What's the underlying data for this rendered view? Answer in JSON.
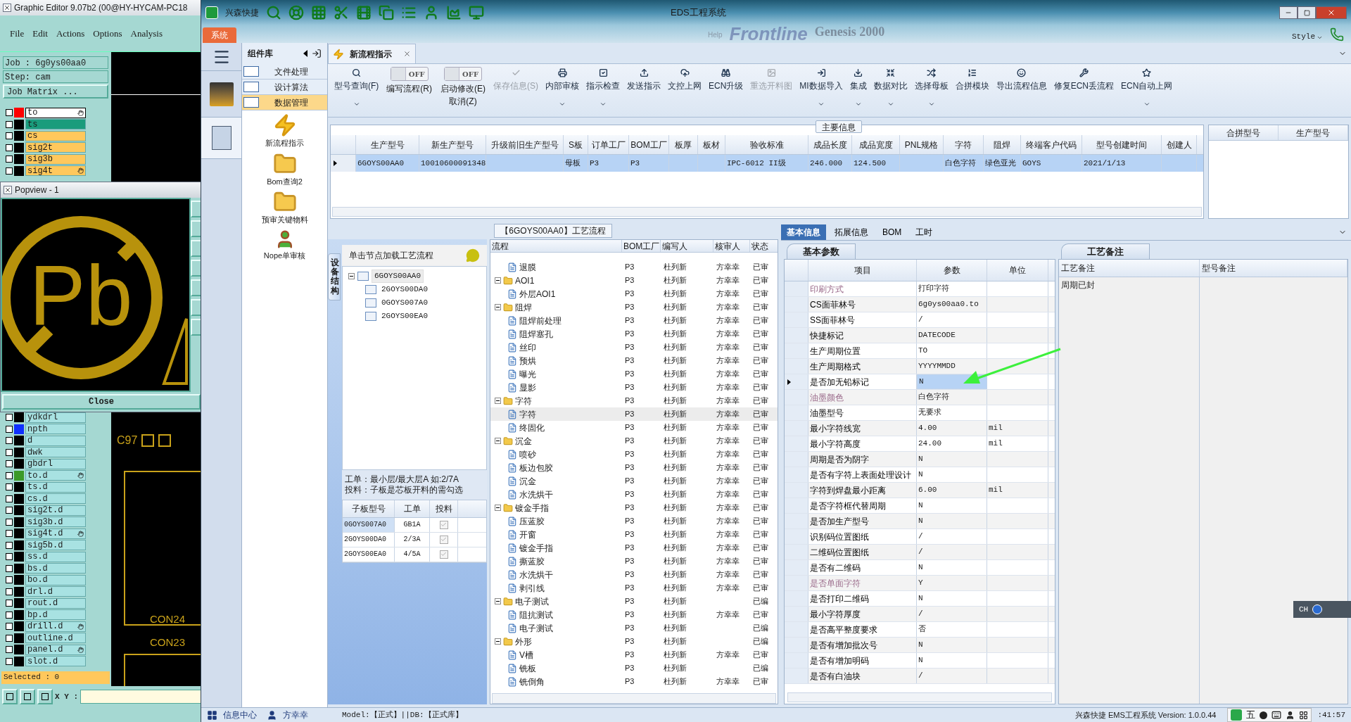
{
  "graphic_editor": {
    "title": "Graphic Editor 9.07b2 (00@HY-HYCAM-PC18",
    "menu": [
      "File",
      "Edit",
      "Actions",
      "Options",
      "Analysis"
    ],
    "job": "Job : 6g0ys00aa0",
    "step": "Step: cam",
    "job_matrix_button": "Job Matrix ...",
    "layers_top": [
      {
        "name": "to",
        "color": "#ffffff",
        "swatch": {
          "color": "#ff0000"
        },
        "selected": true,
        "marked": true,
        "checked": false
      },
      {
        "name": "ts",
        "color": "#1a9c7c",
        "selected": false,
        "marked": false,
        "checked": false
      },
      {
        "name": "cs",
        "color": "#ffc85c",
        "selected": false,
        "marked": false,
        "checked": false
      },
      {
        "name": "sig2t",
        "color": "#ffc85c",
        "selected": false,
        "marked": false,
        "checked": false
      },
      {
        "name": "sig3b",
        "color": "#ffc85c",
        "selected": false,
        "marked": false,
        "checked": false
      },
      {
        "name": "sig4t",
        "color": "#ffc85c",
        "selected": false,
        "marked": true,
        "checked": false
      }
    ],
    "layers_bottom": [
      {
        "name": "ydkdrl",
        "color": "#a8e2e2",
        "selected": false,
        "marked": false,
        "checked": false
      },
      {
        "name": "npth",
        "color": "#a8e2e2",
        "swatch": {
          "color": "#1030ff"
        },
        "selected": false,
        "marked": false,
        "checked": false
      },
      {
        "name": "d",
        "color": "#a8e2e2",
        "selected": false,
        "marked": false,
        "checked": false
      },
      {
        "name": "dwk",
        "color": "#a8e2e2",
        "selected": false,
        "marked": false,
        "checked": false
      },
      {
        "name": "gbdrl",
        "color": "#a8e2e2",
        "selected": false,
        "marked": false,
        "checked": false
      },
      {
        "name": "to.d",
        "color": "#a8e2e2",
        "swatch": {
          "color": "#3c9a28"
        },
        "selected": false,
        "marked": true,
        "checked": false
      },
      {
        "name": "ts.d",
        "color": "#a8e2e2",
        "selected": false,
        "marked": false,
        "checked": false
      },
      {
        "name": "cs.d",
        "color": "#a8e2e2",
        "selected": false,
        "marked": false,
        "checked": false
      },
      {
        "name": "sig2t.d",
        "color": "#a8e2e2",
        "selected": false,
        "marked": false,
        "checked": false
      },
      {
        "name": "sig3b.d",
        "color": "#a8e2e2",
        "selected": false,
        "marked": false,
        "checked": false
      },
      {
        "name": "sig4t.d",
        "color": "#a8e2e2",
        "selected": false,
        "marked": true,
        "checked": false
      },
      {
        "name": "sig5b.d",
        "color": "#a8e2e2",
        "selected": false,
        "marked": false,
        "checked": false
      },
      {
        "name": "ss.d",
        "color": "#a8e2e2",
        "selected": false,
        "marked": false,
        "checked": false
      },
      {
        "name": "bs.d",
        "color": "#a8e2e2",
        "selected": false,
        "marked": false,
        "checked": false
      },
      {
        "name": "bo.d",
        "color": "#a8e2e2",
        "selected": false,
        "marked": false,
        "checked": false
      },
      {
        "name": "drl.d",
        "color": "#a8e2e2",
        "selected": false,
        "marked": false,
        "checked": false
      },
      {
        "name": "rout.d",
        "color": "#a8e2e2",
        "selected": false,
        "marked": false,
        "checked": false
      },
      {
        "name": "bp.d",
        "color": "#a8e2e2",
        "selected": false,
        "marked": false,
        "checked": false
      },
      {
        "name": "drill.d",
        "color": "#a8e2e2",
        "selected": false,
        "marked": true,
        "checked": false
      },
      {
        "name": "outline.d",
        "color": "#a8e2e2",
        "selected": false,
        "marked": false,
        "checked": false
      },
      {
        "name": "panel.d",
        "color": "#a8e2e2",
        "selected": false,
        "marked": true,
        "checked": false
      },
      {
        "name": "slot.d",
        "color": "#a8e2e2",
        "selected": false,
        "marked": false,
        "checked": false
      }
    ],
    "selected_count": "Selected : 0",
    "xy_label": "X Y :",
    "canvas_labels": [
      "C97",
      "CON24",
      "CON23"
    ]
  },
  "popview": {
    "title": "Popview - 1",
    "symbol": "Pb",
    "close_button": "Close"
  },
  "eds": {
    "app_name": "兴森快捷",
    "title": "EDS工程系统",
    "background_texts": [
      "Help",
      "Frontline",
      "Genesis 2000"
    ],
    "style_menu": "Style",
    "ribbon_tab": "系统",
    "library": {
      "title": "组件库",
      "groups": [
        {
          "label": "文件处理",
          "selected": false
        },
        {
          "label": "设计算法",
          "selected": false
        },
        {
          "label": "数据管理",
          "selected": true
        }
      ],
      "tools": [
        {
          "label": "新流程指示",
          "kind": "bolt"
        },
        {
          "label": "Bom查询2",
          "kind": "folder"
        },
        {
          "label": "预审关键物料",
          "kind": "folder"
        },
        {
          "label": "Nope单审核",
          "kind": "person"
        }
      ]
    },
    "doc_tab": {
      "label": "新流程指示",
      "selected": true
    },
    "toolbar": [
      {
        "kind": "button",
        "label": "型号查询(F)",
        "disabled": false,
        "menu": true
      },
      {
        "kind": "toggle",
        "label": "编写流程(R)",
        "toggle_text": "OFF",
        "on": false
      },
      {
        "kind": "toggle",
        "label": "启动修改(E)",
        "label2": "取消(Z)",
        "toggle_text": "OFF",
        "on": false
      },
      {
        "kind": "button",
        "label": "保存信息(S)",
        "disabled": true,
        "menu": false
      },
      {
        "kind": "button",
        "label": "内部审核",
        "disabled": false,
        "menu": true
      },
      {
        "kind": "button",
        "label": "指示检查",
        "disabled": false,
        "menu": true
      },
      {
        "kind": "button",
        "label": "发送指示",
        "disabled": false,
        "menu": false
      },
      {
        "kind": "button",
        "label": "文控上网",
        "disabled": false,
        "menu": false
      },
      {
        "kind": "button",
        "label": "ECN升级",
        "disabled": false,
        "menu": false
      },
      {
        "kind": "button",
        "label": "重选开料图",
        "disabled": true,
        "menu": false
      },
      {
        "kind": "button",
        "label": "MI数据导入",
        "disabled": false,
        "menu": true
      },
      {
        "kind": "button",
        "label": "集成",
        "disabled": false,
        "menu": true
      },
      {
        "kind": "button",
        "label": "数据对比",
        "disabled": false,
        "menu": true
      },
      {
        "kind": "button",
        "label": "选择母板",
        "disabled": false,
        "menu": true
      },
      {
        "kind": "button",
        "label": "合拼模块",
        "disabled": false,
        "menu": false
      },
      {
        "kind": "button",
        "label": "导出流程信息",
        "disabled": false,
        "menu": false
      },
      {
        "kind": "button",
        "label": "修复ECN丢流程",
        "disabled": false,
        "menu": false
      },
      {
        "kind": "button",
        "label": "ECN自动上网",
        "disabled": false,
        "menu": true
      }
    ],
    "main_info": {
      "legend": "主要信息",
      "columns": [
        "生产型号",
        "新生产型号",
        "升级前旧生产型号",
        "S板",
        "订单工厂",
        "BOM工厂",
        "板厚",
        "板材",
        "验收标准",
        "成品长度",
        "成品宽度",
        "PNL规格",
        "字符",
        "阻焊",
        "终端客户代码",
        "型号创建时间",
        "创建人"
      ],
      "rows": [
        {
          "selected": true,
          "cells": [
            "6GOYS00AA0",
            "10010600091348",
            "",
            "母板",
            "P3",
            "P3",
            "",
            "",
            "IPC-6012 II级",
            "246.000",
            "124.500",
            "",
            "白色字符",
            "绿色亚光",
            "GOYS",
            "2021/1/13",
            ""
          ]
        }
      ],
      "merge_columns": [
        "合拼型号",
        "生产型号"
      ]
    },
    "process": {
      "title": "【6GOYS00AA0】工艺流程",
      "side_tab": "设备结构",
      "tree_hint": "单击节点加载工艺流程",
      "tree": [
        {
          "label": "6GOYS00AA0",
          "expanded": true,
          "selected": true,
          "children": [
            {
              "label": "2GOYS00DA0",
              "selected": false
            },
            {
              "label": "0GOYS007A0",
              "selected": false
            },
            {
              "label": "2GOYS00EA0",
              "selected": false
            }
          ]
        }
      ],
      "note": [
        "工单：最小层/最大层A 如:2/7A",
        "投料：子板是芯板开料的需勾选"
      ],
      "sub_columns": [
        "子板型号",
        "工单",
        "投料"
      ],
      "sub_rows": [
        {
          "cells": [
            "0GOYS007A0",
            "GB1A"
          ],
          "checked": true,
          "selected": true
        },
        {
          "cells": [
            "2GOYS00DA0",
            "2/3A"
          ],
          "checked": true,
          "selected": false
        },
        {
          "cells": [
            "2GOYS00EA0",
            "4/5A"
          ],
          "checked": true,
          "selected": false
        }
      ],
      "grid_columns": [
        "流程",
        "BOM工厂",
        "编写人",
        "核审人",
        "状态"
      ],
      "grid_rows": [
        {
          "kind": "step",
          "cells": [
            "退膜",
            "P3",
            "杜列新",
            "方幸幸",
            "已审"
          ],
          "selected": false
        },
        {
          "kind": "group",
          "expanded": true,
          "cells": [
            "AOI1",
            "P3",
            "杜列新",
            "方幸幸",
            "已审"
          ],
          "selected": false,
          "children": [
            {
              "kind": "step",
              "cells": [
                "外层AOI1",
                "P3",
                "杜列新",
                "方幸幸",
                "已审"
              ],
              "selected": false
            }
          ]
        },
        {
          "kind": "group",
          "expanded": true,
          "cells": [
            "阻焊",
            "P3",
            "杜列新",
            "方幸幸",
            "已审"
          ],
          "selected": false,
          "children": [
            {
              "kind": "step",
              "cells": [
                "阻焊前处理",
                "P3",
                "杜列新",
                "方幸幸",
                "已审"
              ],
              "selected": false
            },
            {
              "kind": "step",
              "cells": [
                "阻焊塞孔",
                "P3",
                "杜列新",
                "方幸幸",
                "已审"
              ],
              "selected": false
            },
            {
              "kind": "step",
              "cells": [
                "丝印",
                "P3",
                "杜列新",
                "方幸幸",
                "已审"
              ],
              "selected": false
            },
            {
              "kind": "step",
              "cells": [
                "预烘",
                "P3",
                "杜列新",
                "方幸幸",
                "已审"
              ],
              "selected": false
            },
            {
              "kind": "step",
              "cells": [
                "曝光",
                "P3",
                "杜列新",
                "方幸幸",
                "已审"
              ],
              "selected": false
            },
            {
              "kind": "step",
              "cells": [
                "显影",
                "P3",
                "杜列新",
                "方幸幸",
                "已审"
              ],
              "selected": false
            }
          ]
        },
        {
          "kind": "group",
          "expanded": true,
          "cells": [
            "字符",
            "P3",
            "杜列新",
            "方幸幸",
            "已审"
          ],
          "selected": false,
          "children": [
            {
              "kind": "step",
              "cells": [
                "字符",
                "P3",
                "杜列新",
                "方幸幸",
                "已审"
              ],
              "selected": true
            },
            {
              "kind": "step",
              "cells": [
                "终固化",
                "P3",
                "杜列新",
                "方幸幸",
                "已审"
              ],
              "selected": false
            }
          ]
        },
        {
          "kind": "group",
          "expanded": true,
          "cells": [
            "沉金",
            "P3",
            "杜列新",
            "方幸幸",
            "已审"
          ],
          "selected": false,
          "children": [
            {
              "kind": "step",
              "cells": [
                "喷砂",
                "P3",
                "杜列新",
                "方幸幸",
                "已审"
              ],
              "selected": false
            },
            {
              "kind": "step",
              "cells": [
                "板边包胶",
                "P3",
                "杜列新",
                "方幸幸",
                "已审"
              ],
              "selected": false
            },
            {
              "kind": "step",
              "cells": [
                "沉金",
                "P3",
                "杜列新",
                "方幸幸",
                "已审"
              ],
              "selected": false
            },
            {
              "kind": "step",
              "cells": [
                "水洗烘干",
                "P3",
                "杜列新",
                "方幸幸",
                "已审"
              ],
              "selected": false
            }
          ]
        },
        {
          "kind": "group",
          "expanded": true,
          "cells": [
            "镀金手指",
            "P3",
            "杜列新",
            "方幸幸",
            "已审"
          ],
          "selected": false,
          "children": [
            {
              "kind": "step",
              "cells": [
                "压蓝胶",
                "P3",
                "杜列新",
                "方幸幸",
                "已审"
              ],
              "selected": false
            },
            {
              "kind": "step",
              "cells": [
                "开窗",
                "P3",
                "杜列新",
                "方幸幸",
                "已审"
              ],
              "selected": false
            },
            {
              "kind": "step",
              "cells": [
                "镀金手指",
                "P3",
                "杜列新",
                "方幸幸",
                "已审"
              ],
              "selected": false
            },
            {
              "kind": "step",
              "cells": [
                "撕蓝胶",
                "P3",
                "杜列新",
                "方幸幸",
                "已审"
              ],
              "selected": false
            },
            {
              "kind": "step",
              "cells": [
                "水洗烘干",
                "P3",
                "杜列新",
                "方幸幸",
                "已审"
              ],
              "selected": false
            },
            {
              "kind": "step",
              "cells": [
                "剥引线",
                "P3",
                "杜列新",
                "方幸幸",
                "已审"
              ],
              "selected": false
            }
          ]
        },
        {
          "kind": "group",
          "expanded": true,
          "cells": [
            "电子测试",
            "P3",
            "杜列新",
            "",
            "已编"
          ],
          "selected": false,
          "children": [
            {
              "kind": "step",
              "cells": [
                "阻抗测试",
                "P3",
                "杜列新",
                "方幸幸",
                "已审"
              ],
              "selected": false
            },
            {
              "kind": "step",
              "cells": [
                "电子测试",
                "P3",
                "杜列新",
                "",
                "已编"
              ],
              "selected": false
            }
          ]
        },
        {
          "kind": "group",
          "expanded": true,
          "cells": [
            "外形",
            "P3",
            "杜列新",
            "",
            "已编"
          ],
          "selected": false,
          "children": [
            {
              "kind": "step",
              "cells": [
                "V槽",
                "P3",
                "杜列新",
                "方幸幸",
                "已审"
              ],
              "selected": false
            },
            {
              "kind": "step",
              "cells": [
                "铣板",
                "P3",
                "杜列新",
                "",
                "已编"
              ],
              "selected": false
            },
            {
              "kind": "step",
              "cells": [
                "铣倒角",
                "P3",
                "杜列新",
                "方幸幸",
                "已审"
              ],
              "selected": false
            }
          ]
        }
      ]
    },
    "info_tabs": [
      {
        "label": "基本信息",
        "selected": true
      },
      {
        "label": "拓展信息",
        "selected": false
      },
      {
        "label": "BOM",
        "selected": false
      },
      {
        "label": "工时",
        "selected": false
      }
    ],
    "params": {
      "tab": "基本参数",
      "columns": [
        "项目",
        "参数",
        "单位"
      ],
      "rows": [
        {
          "item": "印刷方式",
          "value": "打印字符",
          "flagged": true,
          "selected": false
        },
        {
          "item": "CS面菲林号",
          "value": "6g0ys00aa0.to",
          "flagged": false,
          "selected": false
        },
        {
          "item": "SS面菲林号",
          "value": "/",
          "flagged": false,
          "selected": false
        },
        {
          "item": "快捷标记",
          "value": "DATECODE",
          "flagged": false,
          "selected": false
        },
        {
          "item": "生产周期位置",
          "value": "TO",
          "flagged": false,
          "selected": false
        },
        {
          "item": "生产周期格式",
          "value": "YYYYMMDD",
          "flagged": false,
          "selected": false
        },
        {
          "item": "是否加无铅标记",
          "value": "N",
          "flagged": false,
          "selected": true
        },
        {
          "item": "油墨颜色",
          "value": "白色字符",
          "flagged": true,
          "selected": false
        },
        {
          "item": "油墨型号",
          "value": "无要求",
          "flagged": false,
          "selected": false
        },
        {
          "item": "最小字符线宽",
          "value": "4.00",
          "unit": "mil",
          "flagged": false,
          "selected": false
        },
        {
          "item": "最小字符高度",
          "value": "24.00",
          "unit": "mil",
          "flagged": false,
          "selected": false
        },
        {
          "item": "周期是否为阴字",
          "value": "N",
          "flagged": false,
          "selected": false
        },
        {
          "item": "是否有字符上表面处理设计",
          "value": "N",
          "flagged": false,
          "selected": false
        },
        {
          "item": "字符到焊盘最小距离",
          "value": "6.00",
          "unit": "mil",
          "flagged": false,
          "selected": false
        },
        {
          "item": "是否字符框代替周期",
          "value": "N",
          "flagged": false,
          "selected": false
        },
        {
          "item": "是否加生产型号",
          "value": "N",
          "flagged": false,
          "selected": false
        },
        {
          "item": "识别码位置图纸",
          "value": "/",
          "flagged": false,
          "selected": false
        },
        {
          "item": "二维码位置图纸",
          "value": "/",
          "flagged": false,
          "selected": false
        },
        {
          "item": "是否有二维码",
          "value": "N",
          "flagged": false,
          "selected": false
        },
        {
          "item": "是否单面字符",
          "value": "Y",
          "flagged": true,
          "selected": false
        },
        {
          "item": "是否打印二维码",
          "value": "N",
          "flagged": false,
          "selected": false
        },
        {
          "item": "最小字符厚度",
          "value": "/",
          "flagged": false,
          "selected": false
        },
        {
          "item": "是否高平整度要求",
          "value": "否",
          "flagged": false,
          "selected": false
        },
        {
          "item": "是否有增加批次号",
          "value": "N",
          "flagged": false,
          "selected": false
        },
        {
          "item": "是否有增加明码",
          "value": "N",
          "flagged": false,
          "selected": false
        },
        {
          "item": "是否有白油块",
          "value": "/",
          "flagged": false,
          "selected": false
        }
      ]
    },
    "remarks": {
      "tab": "工艺备注",
      "columns": [
        "工艺备注",
        "型号备注"
      ],
      "notes": [
        "周期已封"
      ]
    },
    "status_bar": {
      "info_center": "信息中心",
      "user": "方幸幸",
      "model": "Model:【正式】||DB:【正式库】",
      "version": "兴森快捷 EMS工程系统 Version: 1.0.0.44",
      "ime_mode": "五",
      "clock": ":41:57"
    },
    "ime_float": {
      "label": "CH"
    }
  }
}
